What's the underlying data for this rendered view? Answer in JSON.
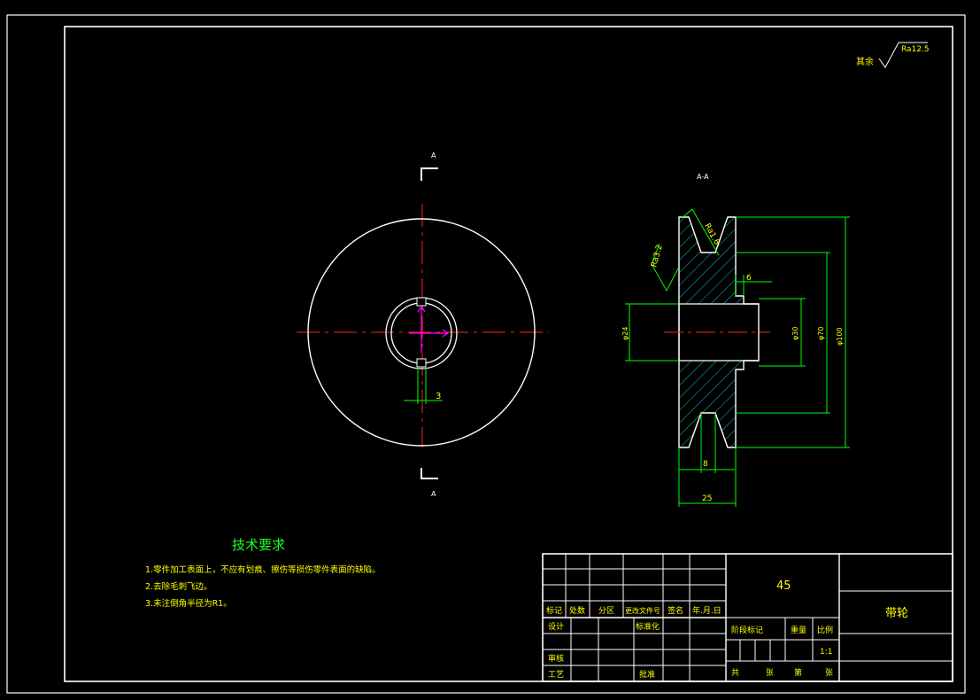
{
  "colors": {
    "background": "#000000",
    "outline": "#ffffff",
    "dimension": "#00ff00",
    "text": "#ffff00",
    "centerline": "#ff0000",
    "hatch": "#00c8c8",
    "annotation": "#ff00ff"
  },
  "roughness_note": {
    "label": "其余",
    "value": "Ra12.5"
  },
  "front_view": {
    "section_marker_top": "A",
    "section_marker_bottom": "A",
    "keyway_dim": "3"
  },
  "section_view": {
    "title": "A-A",
    "roughness_groove": "Ra1.6",
    "roughness_side": "Ra3.2",
    "dim_hub_length": "6",
    "dim_bore": "φ24",
    "dim_hub": "φ30",
    "dim_rim": "φ70",
    "dim_outer": "φ100",
    "dim_groove": "8",
    "dim_width": "25"
  },
  "tech_requirements": {
    "title": "技术要求",
    "items": [
      "1.零件加工表面上，不应有划痕、擦伤等损伤零件表面的缺陷。",
      "2.去除毛刺飞边。",
      "3.未注倒角半径为R1。"
    ]
  },
  "title_block": {
    "material": "45",
    "part_name": "带轮",
    "headers": [
      "标记",
      "处数",
      "分区",
      "更改文件号",
      "签名",
      "年.月.日"
    ],
    "design": "设计",
    "standardization": "标准化",
    "check": "审核",
    "process": "工艺",
    "approve": "批准",
    "stage_mark": "阶段标记",
    "weight": "重量",
    "scale": "比例",
    "scale_value": "1:1",
    "total": "共",
    "sheets1": "张",
    "page": "第",
    "sheets2": "张"
  }
}
